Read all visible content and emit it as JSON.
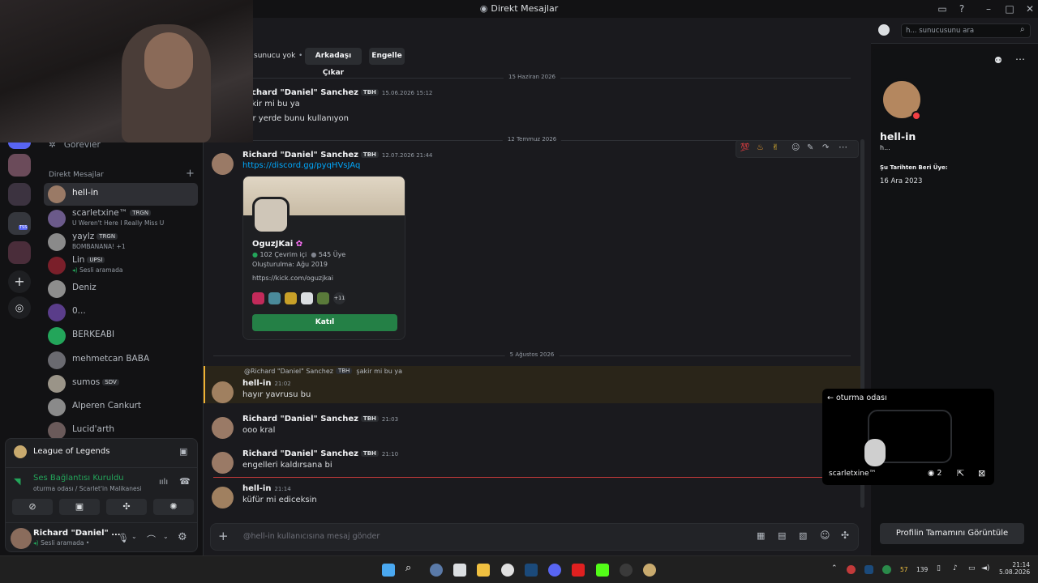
{
  "window": {
    "title": "Direkt Mesajlar"
  },
  "header": {
    "mutual": "sunucu yok",
    "remove_friend": "Arkadaşı Çıkar",
    "block": "Engelle",
    "search_placeholder": "h... sunucusunu ara"
  },
  "sidebar": {
    "quests": "Görevler",
    "dm_header": "Direkt Mesajlar",
    "add": "+",
    "items": [
      {
        "name": "hell-in",
        "sub": ""
      },
      {
        "name": "scarletxine™",
        "tag": "TRGN",
        "sub": "U Weren't Here I Really Miss U"
      },
      {
        "name": "yaylz",
        "tag": "TRGN",
        "sub": "BOMBANANA! +1"
      },
      {
        "name": "Lin",
        "tag": "UPSI",
        "sub": "Sesli aramada"
      },
      {
        "name": "Deniz",
        "sub": ""
      },
      {
        "name": "0...",
        "sub": ""
      },
      {
        "name": "BERKEABI",
        "sub": ""
      },
      {
        "name": "mehmetcan BABA",
        "sub": ""
      },
      {
        "name": "sumos",
        "tag": "SDV",
        "sub": ""
      },
      {
        "name": "Alperen Cankurt",
        "sub": ""
      },
      {
        "name": "Lucid'arth",
        "sub": ""
      }
    ],
    "server_badge": "TSS"
  },
  "activity": {
    "game": "League of Legends"
  },
  "voice": {
    "status": "Ses Bağlantısı Kuruldu",
    "channel": "oturma odası / Scarlet'in Malikanesi"
  },
  "user": {
    "name": "Richard \"Daniel\" ...",
    "status": "Sesli aramada •"
  },
  "chat": {
    "date1": "15 Haziran 2026",
    "date2": "12 Temmuz 2026",
    "date3": "5 Ağustos 2026",
    "m1": {
      "author": "Richard \"Daniel\" Sanchez",
      "tag": "TBH",
      "time": "15.06.2026 15:12",
      "lines": [
        "şakir mi bu ya",
        "her yerde bunu kullanıyon"
      ]
    },
    "m2": {
      "author": "Richard \"Daniel\" Sanchez",
      "tag": "TBH",
      "time": "12.07.2026 21:44",
      "link": "https://discord.gg/pyqHVsJAq"
    },
    "invite": {
      "name": "OguzJKai",
      "online": "102 Çevrim içi",
      "members": "545 Üye",
      "created": "Oluşturulma: Ağu 2019",
      "desc": "https://kick.com/oguzjkai",
      "extra": "+11",
      "join": "Katıl"
    },
    "reply": {
      "ref_author": "@Richard \"Daniel\" Sanchez",
      "ref_tag": "TBH",
      "ref_text": "şakir mi bu ya"
    },
    "m3": {
      "author": "hell-in",
      "time": "21:02",
      "text": "hayır yavrusu bu"
    },
    "m4": {
      "author": "Richard \"Daniel\" Sanchez",
      "tag": "TBH",
      "time": "21:03",
      "text": "ooo kral"
    },
    "m5": {
      "author": "Richard \"Daniel\" Sanchez",
      "tag": "TBH",
      "time": "21:10",
      "text": "engelleri kaldırsana bi"
    },
    "m6": {
      "author": "hell-in",
      "time": "21:14",
      "text": "küfür mi ediceksin"
    },
    "composer_placeholder": "@hell-in kullanıcısına mesaj gönder"
  },
  "profile": {
    "display_name": "hell-in",
    "username": "h...",
    "member_since_label": "Şu Tarihten Beri Üye:",
    "member_since": "16 Ara 2023",
    "view_full": "Profilin Tamamını Görüntüle"
  },
  "popout": {
    "channel": "oturma odası",
    "user": "scarletxine™",
    "viewers": "2"
  },
  "taskbar": {
    "tray_number1": "57",
    "tray_number2": "139",
    "time": "21:14",
    "date": "5.08.2026"
  },
  "colors": {
    "accent": "#5865f2",
    "join_green": "#248046",
    "link": "#00a8fc",
    "online": "#23a55a",
    "dnd": "#f23f43"
  }
}
